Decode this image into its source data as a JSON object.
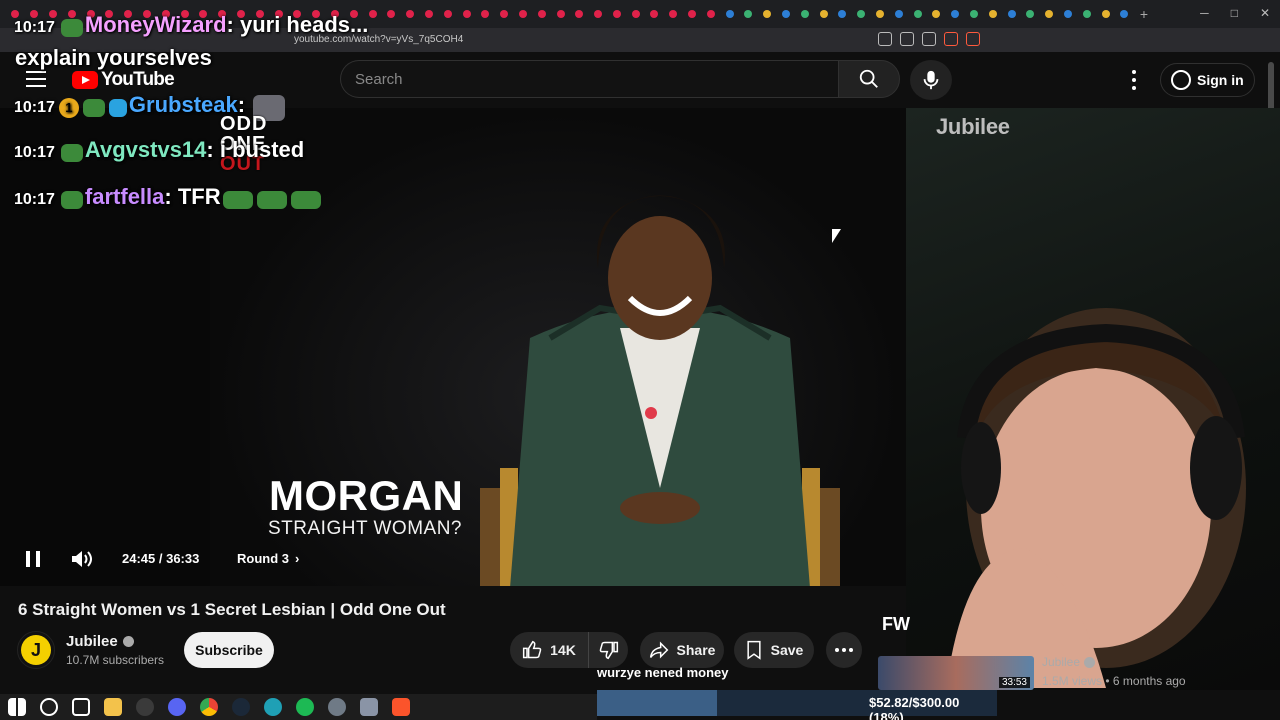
{
  "browser": {
    "url": "youtube.com/watch?v=yVs_7q5COH4",
    "tab_colors": [
      "#e0224a",
      "#3bb273",
      "#e5b22f",
      "#2d7fd6"
    ]
  },
  "header": {
    "logo_text": "YouTube",
    "search_placeholder": "Search",
    "signin_label": "Sign in"
  },
  "video": {
    "watermark": "Jubilee",
    "lower_third_name": "MORGAN",
    "lower_third_sub": "STRAIGHT WOMAN?",
    "time": "24:45 / 36:33",
    "chapter": "Round 3",
    "progress_fraction": 0.945,
    "buffer_marker": 0.242
  },
  "meta": {
    "title": "6 Straight Women vs 1 Secret Lesbian | Odd One Out",
    "channel_name": "Jubilee",
    "channel_avatar_letter": "J",
    "subscribers": "10.7M subscribers",
    "subscribe_label": "Subscribe",
    "likes": "14K",
    "share_label": "Share",
    "save_label": "Save"
  },
  "chat": [
    {
      "time": "10:17",
      "user": "MoneyWizard",
      "user_color": "#f5a0ff",
      "message": "yuri heads..."
    },
    {
      "time": "",
      "user": "",
      "user_color": "#ffffff",
      "message": "explain yourselves"
    },
    {
      "time": "10:17",
      "user": "Grubsteak",
      "user_color": "#4aa8ff",
      "message": ""
    },
    {
      "time": "10:17",
      "user": "Avgvstvs14",
      "user_color": "#7fe8c0",
      "message": "i busted"
    },
    {
      "time": "10:17",
      "user": "fartfella",
      "user_color": "#c88cff",
      "message": "TFR"
    }
  ],
  "chat_badge": "1",
  "odd_one_out": [
    "ODD",
    "ONE",
    "OUT"
  ],
  "overlay": {
    "fw_text": "FW",
    "donation_msg": "wurzye nened money",
    "goal_text": "$52.82/$300.00 (18%)",
    "goal_fraction": 0.18
  },
  "related": {
    "channel": "Jubilee",
    "meta": "1.5M views • 6 months ago",
    "duration": "33:53"
  }
}
